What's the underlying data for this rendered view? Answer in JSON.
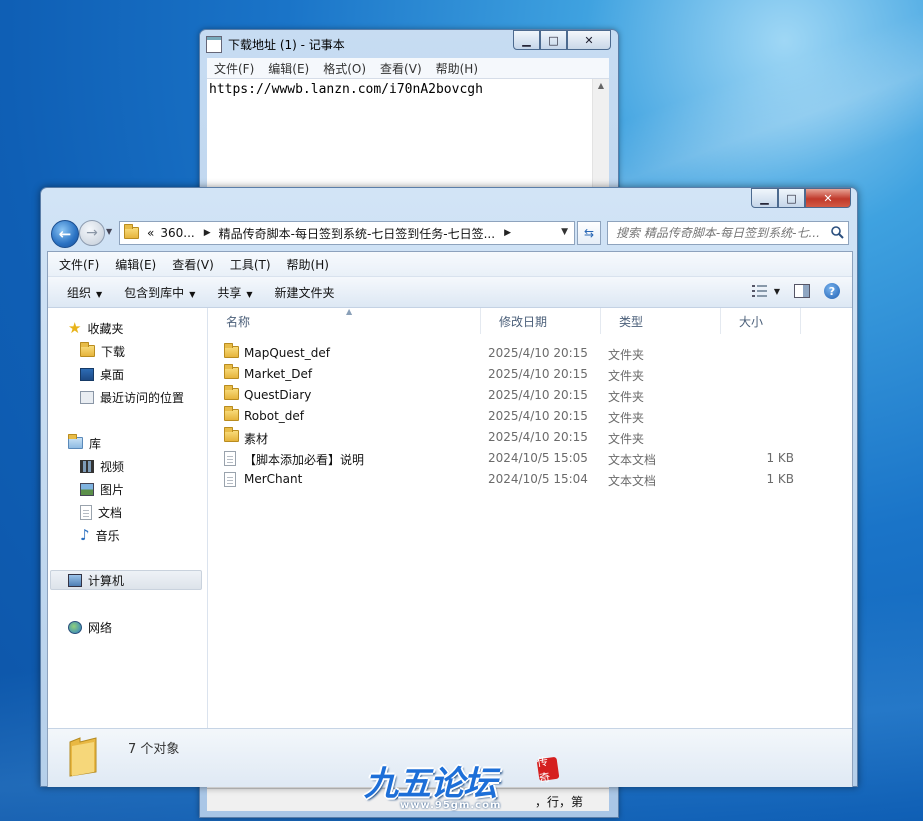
{
  "notepad": {
    "title": "下载地址 (1) - 记事本",
    "menu": [
      "文件(F)",
      "编辑(E)",
      "格式(O)",
      "查看(V)",
      "帮助(H)"
    ],
    "content": "https://wwwb.lanzn.com/i70nA2bovcgh",
    "status_text": "，行，第"
  },
  "explorer": {
    "address": {
      "chevron": "«",
      "crumbs": [
        "360...",
        "精品传奇脚本-每日签到系统-七日签到任务-七日签..."
      ]
    },
    "search_placeholder": "搜索 精品传奇脚本-每日签到系统-七...",
    "menu": [
      "文件(F)",
      "编辑(E)",
      "查看(V)",
      "工具(T)",
      "帮助(H)"
    ],
    "commands": {
      "organize": "组织",
      "include_in_library": "包含到库中",
      "share": "共享",
      "new_folder": "新建文件夹"
    },
    "nav": {
      "favorites": "收藏夹",
      "downloads": "下载",
      "desktop": "桌面",
      "recent": "最近访问的位置",
      "libraries": "库",
      "videos": "视频",
      "pictures": "图片",
      "documents": "文档",
      "music": "音乐",
      "computer": "计算机",
      "network": "网络"
    },
    "columns": {
      "name": "名称",
      "modified": "修改日期",
      "type": "类型",
      "size": "大小"
    },
    "files": [
      {
        "name": "MapQuest_def",
        "date": "2025/4/10 20:15",
        "type": "文件夹",
        "size": "",
        "kind": "folder"
      },
      {
        "name": "Market_Def",
        "date": "2025/4/10 20:15",
        "type": "文件夹",
        "size": "",
        "kind": "folder"
      },
      {
        "name": "QuestDiary",
        "date": "2025/4/10 20:15",
        "type": "文件夹",
        "size": "",
        "kind": "folder"
      },
      {
        "name": "Robot_def",
        "date": "2025/4/10 20:15",
        "type": "文件夹",
        "size": "",
        "kind": "folder"
      },
      {
        "name": "素材",
        "date": "2025/4/10 20:15",
        "type": "文件夹",
        "size": "",
        "kind": "folder"
      },
      {
        "name": "【脚本添加必看】说明",
        "date": "2024/10/5 15:05",
        "type": "文本文档",
        "size": "1 KB",
        "kind": "text"
      },
      {
        "name": "MerChant",
        "date": "2024/10/5 15:04",
        "type": "文本文档",
        "size": "1 KB",
        "kind": "text"
      }
    ],
    "item_count": "7 个对象"
  },
  "watermark": {
    "logo_text": "九五论坛",
    "url": "www.95gm.com",
    "seal": "传奇"
  }
}
